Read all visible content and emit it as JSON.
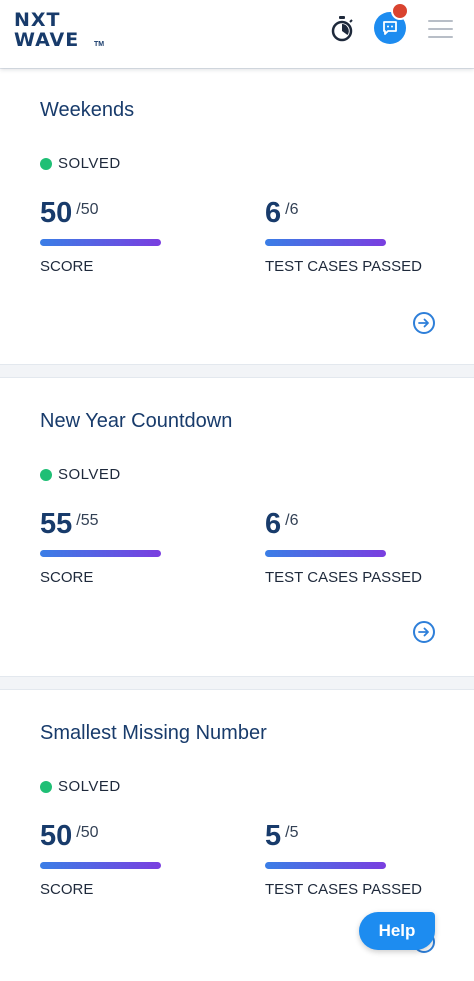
{
  "header": {
    "logo_line1": "NXT",
    "logo_line2": "WAVE",
    "logo_tm": "TM",
    "icons": [
      "timer-icon",
      "chat-icon",
      "menu-icon"
    ],
    "colors": {
      "brand": "#183b6b",
      "chat": "#1d8cf0",
      "notification": "#d9432f"
    }
  },
  "problems": [
    {
      "title": "Weekends",
      "status": "SOLVED",
      "score": "50",
      "score_total": "/50",
      "score_label": "SCORE",
      "tests": "6",
      "tests_total": "/6",
      "tests_label": "TEST CASES PASSED",
      "score_fraction": 1.0,
      "tests_fraction": 1.0
    },
    {
      "title": "New Year Countdown",
      "status": "SOLVED",
      "score": "55",
      "score_total": "/55",
      "score_label": "SCORE",
      "tests": "6",
      "tests_total": "/6",
      "tests_label": "TEST CASES PASSED",
      "score_fraction": 1.0,
      "tests_fraction": 1.0
    },
    {
      "title": "Smallest Missing Number",
      "status": "SOLVED",
      "score": "50",
      "score_total": "/50",
      "score_label": "SCORE",
      "tests": "5",
      "tests_total": "/5",
      "tests_label": "TEST CASES PASSED",
      "score_fraction": 1.0,
      "tests_fraction": 1.0
    }
  ],
  "help": {
    "label": "Help"
  },
  "colors": {
    "solved": "#1fbf75",
    "bar_start": "#3a7ee6",
    "bar_end": "#7a3ee0",
    "arrow": "#2e7fd9"
  }
}
